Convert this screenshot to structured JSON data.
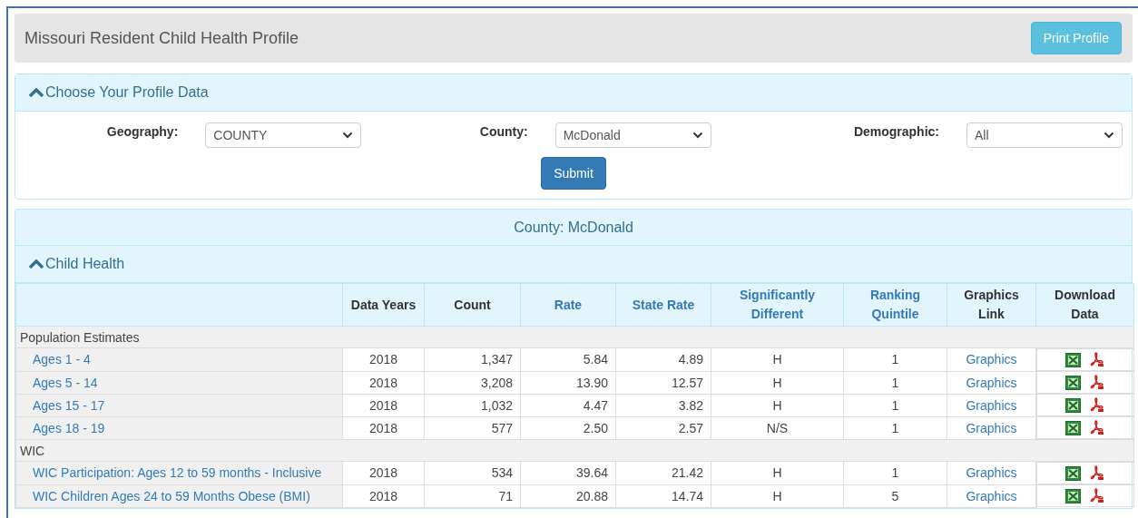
{
  "header": {
    "title": "Missouri Resident Child Health Profile",
    "print_button": "Print Profile"
  },
  "profile_panel": {
    "title": "Choose Your Profile Data",
    "expanded": true,
    "filters": [
      {
        "label": "Geography:",
        "value": "COUNTY"
      },
      {
        "label": "County:",
        "value": "McDonald"
      },
      {
        "label": "Demographic:",
        "value": "All"
      }
    ],
    "submit": "Submit"
  },
  "county_banner": "County: McDonald",
  "section": {
    "title": "Child Health",
    "expanded": true
  },
  "table": {
    "columns": [
      {
        "label": "Data Years",
        "sortable": false
      },
      {
        "label": "Count",
        "sortable": false
      },
      {
        "label": "Rate",
        "sortable": true
      },
      {
        "label": "State Rate",
        "sortable": true
      },
      {
        "label": "Significantly Different",
        "sortable": true
      },
      {
        "label": "Ranking Quintile",
        "sortable": true
      },
      {
        "label": "Graphics Link",
        "sortable": false
      },
      {
        "label": "Download Data",
        "sortable": false
      }
    ],
    "rows": [
      {
        "kind": "group",
        "label": "Population Estimates"
      },
      {
        "kind": "data",
        "label": "Ages 1 - 4",
        "years": "2018",
        "count": "1,347",
        "rate": "5.84",
        "state_rate": "4.89",
        "significant": "H",
        "quintile": "1",
        "graphics": "Graphics"
      },
      {
        "kind": "data",
        "label": "Ages 5 - 14",
        "years": "2018",
        "count": "3,208",
        "rate": "13.90",
        "state_rate": "12.57",
        "significant": "H",
        "quintile": "1",
        "graphics": "Graphics"
      },
      {
        "kind": "data",
        "label": "Ages 15 - 17",
        "years": "2018",
        "count": "1,032",
        "rate": "4.47",
        "state_rate": "3.82",
        "significant": "H",
        "quintile": "1",
        "graphics": "Graphics"
      },
      {
        "kind": "data",
        "label": "Ages 18 - 19",
        "years": "2018",
        "count": "577",
        "rate": "2.50",
        "state_rate": "2.57",
        "significant": "N/S",
        "quintile": "1",
        "graphics": "Graphics"
      },
      {
        "kind": "group",
        "label": "WIC"
      },
      {
        "kind": "data",
        "label": "WIC Participation: Ages 12 to 59 months - Inclusive",
        "years": "2018",
        "count": "534",
        "rate": "39.64",
        "state_rate": "21.42",
        "significant": "H",
        "quintile": "1",
        "graphics": "Graphics"
      },
      {
        "kind": "data",
        "label": "WIC Children Ages 24 to 59 Months Obese (BMI)",
        "years": "2018",
        "count": "71",
        "rate": "20.88",
        "state_rate": "14.74",
        "significant": "H",
        "quintile": "5",
        "graphics": "Graphics"
      }
    ]
  }
}
